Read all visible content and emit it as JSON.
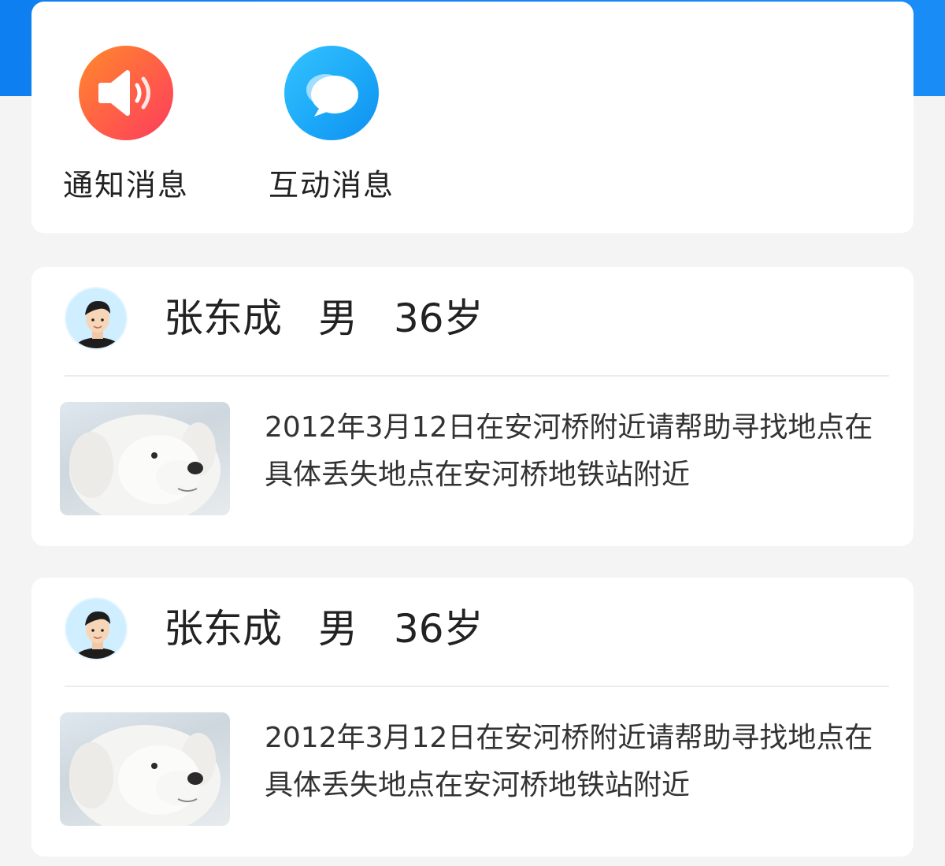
{
  "quick_actions": [
    {
      "label": "通知消息",
      "icon": "speaker-icon",
      "color": "#ff6a3d"
    },
    {
      "label": "互动消息",
      "icon": "chat-bubbles-icon",
      "color": "#1aa6f7"
    }
  ],
  "posts": [
    {
      "name": "张东成",
      "gender": "男",
      "age": "36岁",
      "text": "2012年3月12日在安河桥附近请帮助寻找地点在具体丢失地点在安河桥地铁站附近"
    },
    {
      "name": "张东成",
      "gender": "男",
      "age": "36岁",
      "text": "2012年3月12日在安河桥附近请帮助寻找地点在具体丢失地点在安河桥地铁站附近"
    }
  ],
  "colors": {
    "header_blue": "#0d7ff0",
    "background": "#f4f4f4"
  }
}
